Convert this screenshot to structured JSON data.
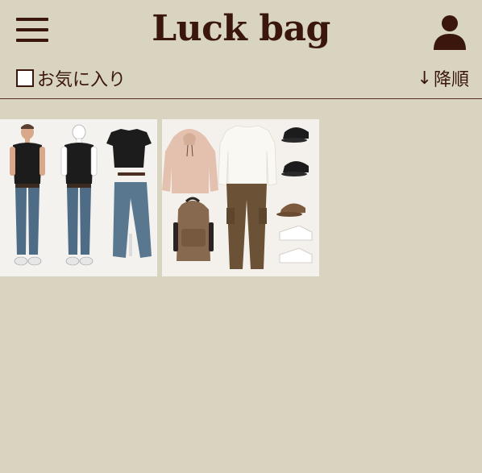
{
  "header": {
    "title": "Luck bag",
    "menu_icon": "hamburger-menu-icon",
    "account_icon": "user-icon"
  },
  "filter": {
    "favorite_label": "お気に入り",
    "favorite_checked": false,
    "sort_arrow": "↓",
    "sort_label": "降順"
  },
  "colors": {
    "background": "#d8d4c0",
    "accent": "#3a160c"
  },
  "products": [
    {
      "name": "outfit-casual-black-tee-jeans"
    },
    {
      "name": "outfit-hoodie-cargo-cap-set"
    }
  ]
}
